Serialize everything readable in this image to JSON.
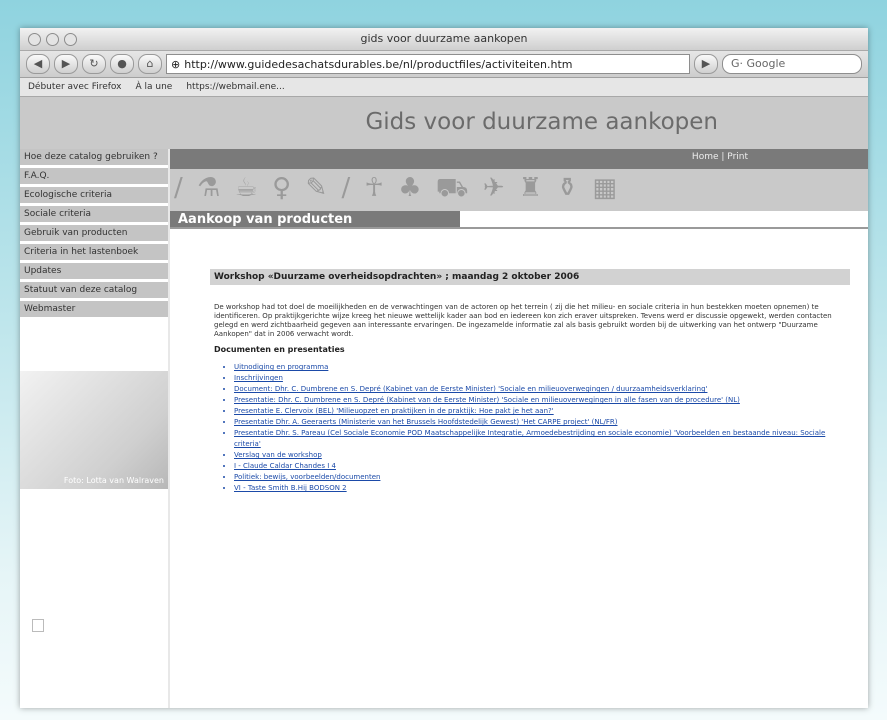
{
  "browser": {
    "window_title": "gids voor duurzame aankopen",
    "url": "http://www.guidedesachatsdurables.be/nl/productfiles/activiteiten.htm",
    "search_placeholder": "Google",
    "bookmarks": [
      "Débuter avec Firefox",
      "À la une",
      "https://webmail.ene..."
    ]
  },
  "site": {
    "title": "Gids voor duurzame aankopen",
    "topnav": {
      "home": "Home",
      "separator": "|",
      "print": "Print"
    },
    "section_title": "Aankoop van producten",
    "icons": "/ ⚗ ☕ ♀ ✎ / ☥ ♣ ⛟ ✈ ♜ ⚱ ▦",
    "photo_caption": "Foto: Lotta van Walraven"
  },
  "sidebar": {
    "items": [
      "Hoe deze catalog gebruiken ?",
      "F.A.Q.",
      "Ecologische criteria",
      "Sociale criteria",
      "Gebruik van producten",
      "Criteria in het lastenboek",
      "Updates",
      "Statuut van deze catalog",
      "Webmaster"
    ]
  },
  "content": {
    "workshop_title": "Workshop «Duurzame overheidsopdrachten» ; maandag 2 oktober 2006",
    "intro": "De workshop had tot doel de moeilijkheden en de verwachtingen van de actoren op het terrein ( zij die het milieu- en sociale criteria in hun bestekken moeten opnemen) te identificeren. Op praktijkgerichte wijze kreeg het nieuwe wettelijk kader aan bod en iedereen kon zich eraver uitspreken. Tevens werd er discussie opgewekt, werden contacten gelegd en werd zichtbaarheid gegeven aan interessante ervaringen. De ingezamelde informatie zal als basis gebruikt worden bij de uitwerking van het ontwerp \"Duurzame Aankopen\" dat in 2006 verwacht wordt.",
    "docs_heading": "Documenten en presentaties",
    "links": [
      "Uitnodiging en programma",
      "Inschrijvingen",
      "Document: Dhr. C. Dumbrene en S. Depré (Kabinet van de Eerste Minister) 'Sociale en milieuoverwegingen / duurzaamheidsverklaring'",
      "Presentatie: Dhr. C. Dumbrene en S. Depré (Kabinet van de Eerste Minister) 'Sociale en milieuoverwegingen in alle fasen van de procedure' (NL)",
      "Presentatie E. Clervoix (BEL) 'Milieuopzet en praktijken in de praktijk: Hoe pakt je het aan?'",
      "Presentatie Dhr. A. Geeraerts (Ministerie van het Brussels Hoofdstedelijk Gewest) 'Het CARPE project' (NL/FR)",
      "Presentatie Dhr. S. Pareau (Cel Sociale Economie POD Maatschappelijke Integratie, Armoedebestrijding en sociale economie) 'Voorbeelden en bestaande niveau: Sociale criteria'",
      "Verslag van de workshop",
      "I - Claude Caldar Chandes I 4",
      "Politiek: bewijs, voorbeelden/documenten",
      "VI - Taste Smith B.Hij BODSON 2"
    ]
  }
}
